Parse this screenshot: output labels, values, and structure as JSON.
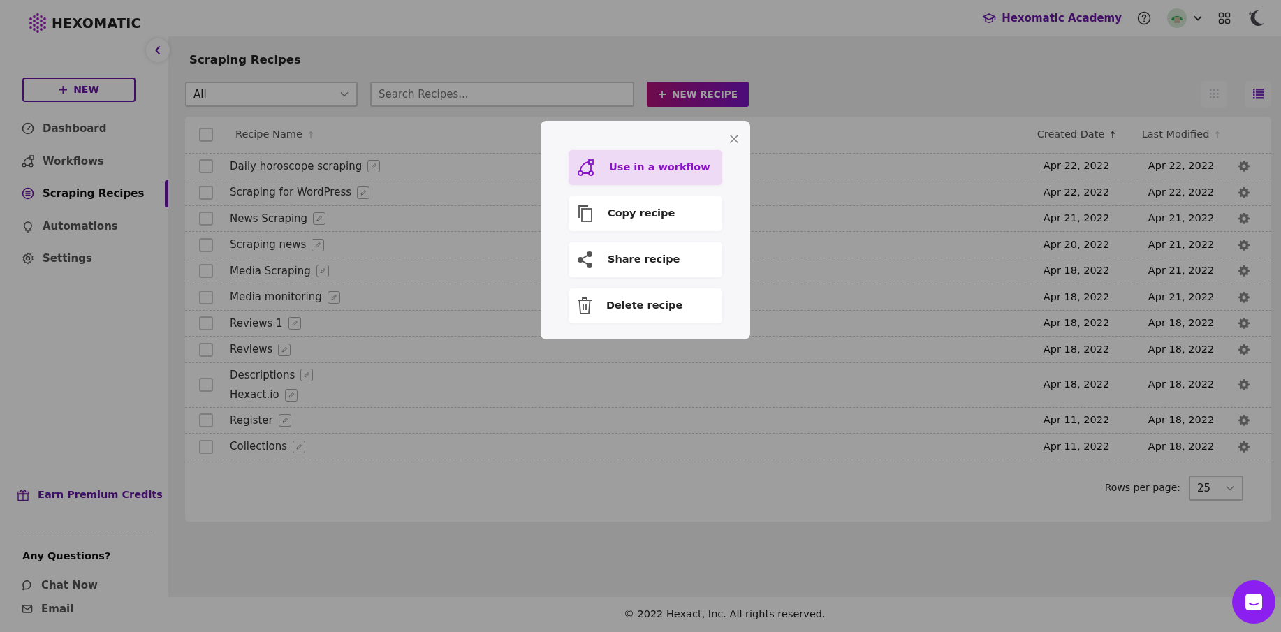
{
  "sidebar": {
    "logo": "HEXOMATIC",
    "new_button": "NEW",
    "items": [
      {
        "label": "Dashboard",
        "kind": "dashboard",
        "selected": false
      },
      {
        "label": "Workflows",
        "kind": "workflows",
        "selected": false
      },
      {
        "label": "Scraping Recipes",
        "kind": "recipes",
        "selected": true
      },
      {
        "label": "Automations",
        "kind": "automations",
        "selected": false
      },
      {
        "label": "Settings",
        "kind": "settings",
        "selected": false
      }
    ],
    "earn_credits": "Earn Premium Credits",
    "questions_heading": "Any Questions?",
    "contact": [
      {
        "label": "Chat Now",
        "kind": "chat"
      },
      {
        "label": "Email",
        "kind": "email"
      }
    ]
  },
  "header": {
    "academy": "Hexomatic Academy"
  },
  "page_title": "Scraping Recipes",
  "filter": {
    "value": "All"
  },
  "search": {
    "placeholder": "Search Recipes..."
  },
  "new_recipe_button": "NEW RECIPE",
  "view_toggle": [
    {
      "kind": "grid",
      "selected": false
    },
    {
      "kind": "list",
      "selected": true
    }
  ],
  "table": {
    "select_all_checked": false,
    "columns": [
      {
        "label": "Recipe Name",
        "sorted": false
      },
      {
        "label": "Created Date",
        "sorted": true
      },
      {
        "label": "Last Modified",
        "sorted": false
      }
    ],
    "rows": [
      {
        "names": [
          "Daily horoscope scraping"
        ],
        "created": "Apr 22, 2022",
        "modified": "Apr 22, 2022",
        "checked": false
      },
      {
        "names": [
          "Scraping for WordPress"
        ],
        "created": "Apr 22, 2022",
        "modified": "Apr 22, 2022",
        "checked": false
      },
      {
        "names": [
          "News Scraping"
        ],
        "created": "Apr 21, 2022",
        "modified": "Apr 21, 2022",
        "checked": false
      },
      {
        "names": [
          "Scraping news"
        ],
        "created": "Apr 20, 2022",
        "modified": "Apr 21, 2022",
        "checked": false
      },
      {
        "names": [
          "Media Scraping"
        ],
        "created": "Apr 18, 2022",
        "modified": "Apr 21, 2022",
        "checked": false
      },
      {
        "names": [
          "Media monitoring"
        ],
        "created": "Apr 18, 2022",
        "modified": "Apr 21, 2022",
        "checked": false
      },
      {
        "names": [
          "Reviews 1"
        ],
        "created": "Apr 18, 2022",
        "modified": "Apr 18, 2022",
        "checked": false
      },
      {
        "names": [
          "Reviews"
        ],
        "created": "Apr 18, 2022",
        "modified": "Apr 18, 2022",
        "checked": false
      },
      {
        "names": [
          "Descriptions",
          "Hexact.io"
        ],
        "created": "Apr 18, 2022",
        "modified": "Apr 18, 2022",
        "checked": false
      },
      {
        "names": [
          "Register"
        ],
        "created": "Apr 11, 2022",
        "modified": "Apr 18, 2022",
        "checked": false
      },
      {
        "names": [
          "Collections"
        ],
        "created": "Apr 11, 2022",
        "modified": "Apr 18, 2022",
        "checked": false
      }
    ]
  },
  "pagination": {
    "label": "Rows per page:",
    "value": "25"
  },
  "footer": "© 2022 Hexact, Inc. All rights reserved.",
  "modal": {
    "actions": [
      {
        "label": "Use in a workflow",
        "kind": "workflow",
        "selected": true
      },
      {
        "label": "Copy recipe",
        "kind": "copy",
        "selected": false
      },
      {
        "label": "Share recipe",
        "kind": "share",
        "selected": false
      },
      {
        "label": "Delete recipe",
        "kind": "delete",
        "selected": false
      }
    ]
  }
}
